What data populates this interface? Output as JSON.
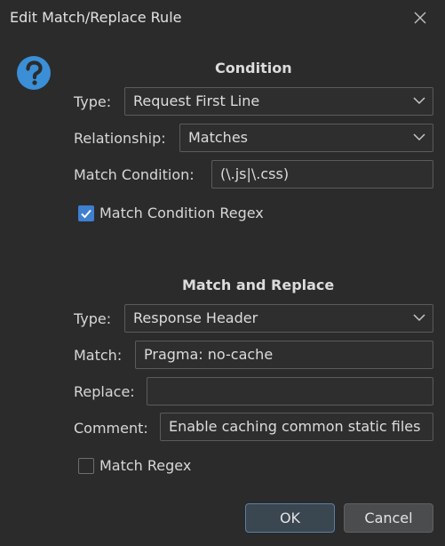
{
  "window": {
    "title": "Edit Match/Replace Rule"
  },
  "condition": {
    "heading": "Condition",
    "type_label": "Type:",
    "type_value": "Request First Line",
    "relationship_label": "Relationship:",
    "relationship_value": "Matches",
    "match_condition_label": "Match Condition:",
    "match_condition_value": "(\\.js|\\.css)",
    "regex_label": "Match Condition Regex",
    "regex_checked": true
  },
  "match_replace": {
    "heading": "Match and Replace",
    "type_label": "Type:",
    "type_value": "Response Header",
    "match_label": "Match:",
    "match_value": "Pragma: no-cache",
    "replace_label": "Replace:",
    "replace_value": "",
    "comment_label": "Comment:",
    "comment_value": "Enable caching common static files",
    "regex_label": "Match Regex",
    "regex_checked": false
  },
  "buttons": {
    "ok": "OK",
    "cancel": "Cancel"
  },
  "icons": {
    "help": "help-icon",
    "close": "close-icon",
    "dropdown": "chevron-down-icon",
    "check": "checkmark-icon"
  },
  "colors": {
    "accent": "#3e7fd1",
    "help_icon": "#3b8fd6",
    "background": "#2b2b2b"
  }
}
